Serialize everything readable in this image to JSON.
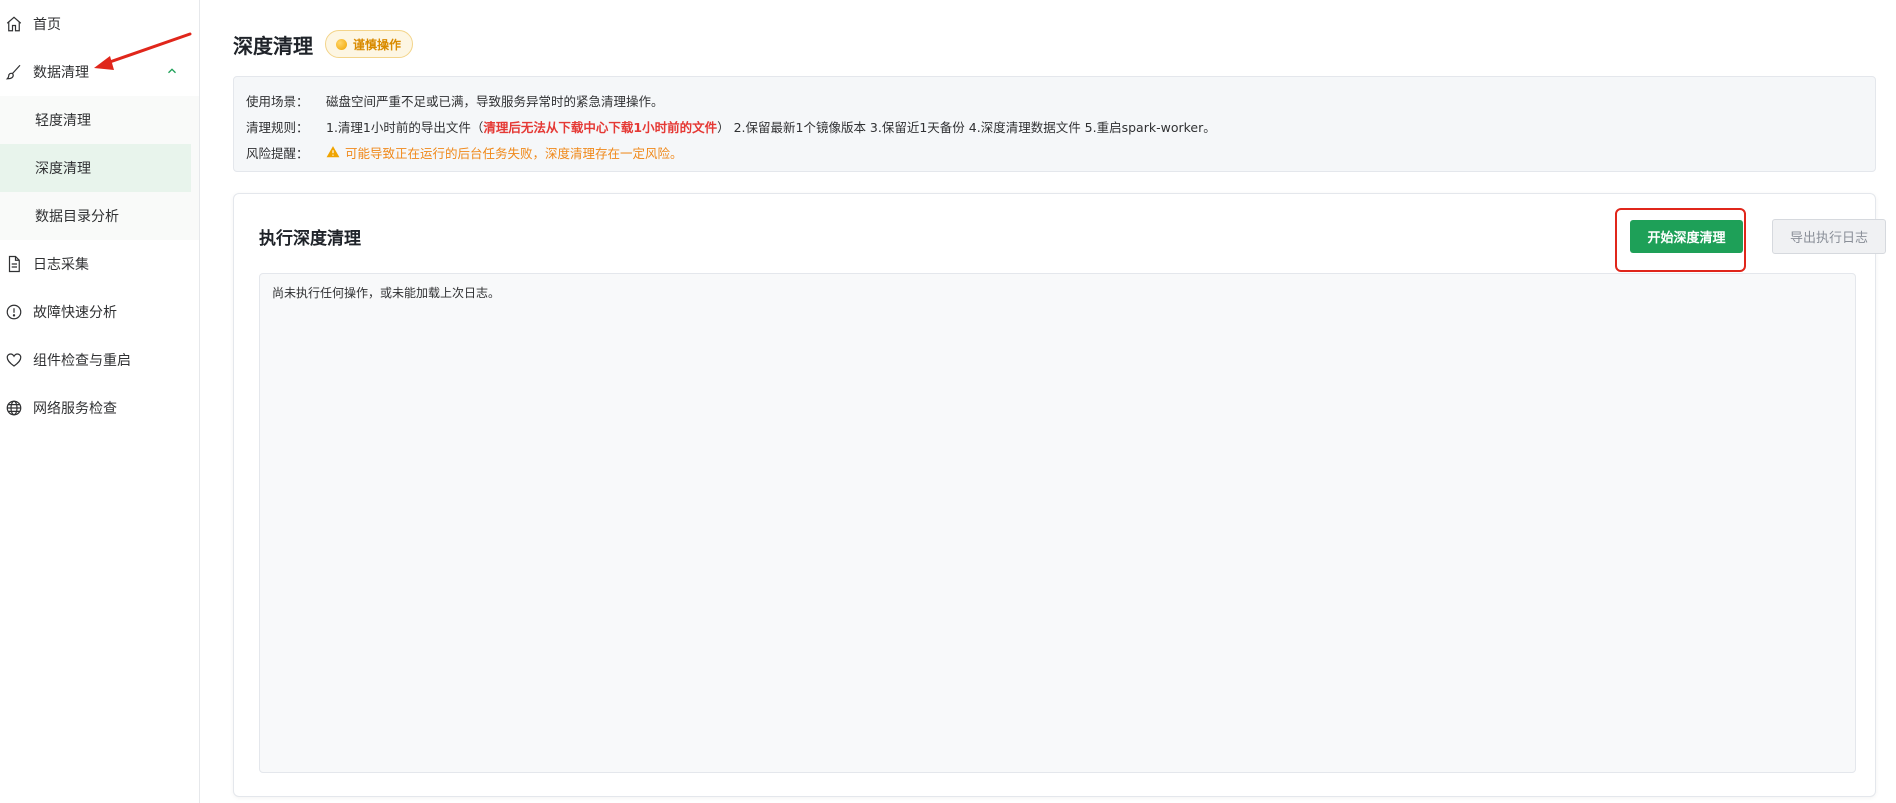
{
  "sidebar": {
    "items": [
      {
        "label": "首页",
        "icon": "home-icon"
      },
      {
        "label": "数据清理",
        "icon": "brush-icon",
        "expanded": true
      },
      {
        "label": "日志采集",
        "icon": "document-icon"
      },
      {
        "label": "故障快速分析",
        "icon": "alert-circle-icon"
      },
      {
        "label": "组件检查与重启",
        "icon": "heart-icon"
      },
      {
        "label": "网络服务检查",
        "icon": "globe-icon"
      }
    ],
    "submenu": [
      {
        "label": "轻度清理",
        "active": false
      },
      {
        "label": "深度清理",
        "active": true
      },
      {
        "label": "数据目录分析",
        "active": false
      }
    ]
  },
  "header": {
    "title": "深度清理",
    "badge": "谨慎操作"
  },
  "info": {
    "scene_label": "使用场景：",
    "scene_text": "磁盘空间严重不足或已满，导致服务异常时的紧急清理操作。",
    "rules_label": "清理规则：",
    "rules_prefix": "1.清理1小时前的导出文件（",
    "rules_highlight": "清理后无法从下载中心下载1小时前的文件",
    "rules_suffix": "） 2.保留最新1个镜像版本 3.保留近1天备份 4.深度清理数据文件 5.重启spark-worker。",
    "risk_label": "风险提醒：",
    "risk_text": "可能导致正在运行的后台任务失败，深度清理存在一定风险。"
  },
  "card": {
    "title": "执行深度清理",
    "start_button": "开始深度清理",
    "export_button": "导出执行日志",
    "log_text": "尚未执行任何操作，或未能加载上次日志。"
  },
  "colors": {
    "primary": "#1ea058",
    "danger": "#e53935",
    "warning": "#f0891a",
    "annotation": "#e0261b"
  }
}
